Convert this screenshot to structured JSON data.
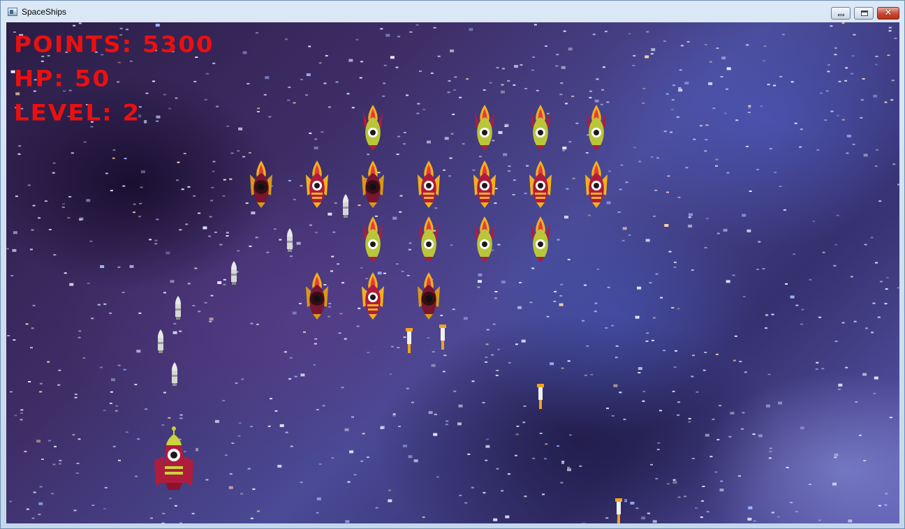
{
  "window": {
    "title": "SpaceShips",
    "icons": {
      "app": "window-app-icon",
      "minimize": "minimize-icon",
      "maximize": "maximize-icon",
      "close": "close-icon"
    },
    "close_glyph": "✕"
  },
  "hud": {
    "points": "POINTS: 5300",
    "hp": "HP: 50",
    "level": "LEVEL: 2",
    "color": "#ea1010"
  },
  "colors": {
    "enemy_green_body": "#b9c63a",
    "enemy_red_body": "#b01c3c",
    "enemy_flame": "#f2b01e",
    "player_body": "#b01c3c",
    "player_accent": "#c9d43c"
  },
  "sprites": {
    "enemy_green": "green-alien-ship-icon",
    "enemy_red": "red-alien-ship-icon",
    "enemy_damaged": "damaged-alien-ship-icon",
    "player": "player-rocket-icon",
    "player_bullet": "player-bullet-icon",
    "enemy_bullet": "enemy-bullet-icon"
  }
}
